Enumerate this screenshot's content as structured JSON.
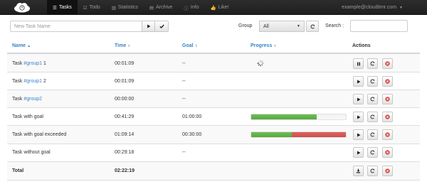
{
  "nav": {
    "logo_icon": "cloud-clock-icon",
    "items": [
      {
        "label": "Tasks",
        "icon": "list-icon",
        "glyph": "☰",
        "active": true
      },
      {
        "label": "Todo",
        "icon": "checkbox-icon",
        "glyph": "☑",
        "active": false
      },
      {
        "label": "Statistics",
        "icon": "bar-chart-icon",
        "glyph": "▥",
        "active": false
      },
      {
        "label": "Archive",
        "icon": "archive-icon",
        "glyph": "▤",
        "active": false
      },
      {
        "label": "Info",
        "icon": "info-icon",
        "glyph": "ⓘ",
        "active": false
      },
      {
        "label": "Like!",
        "icon": "thumbs-up-icon",
        "glyph": "👍",
        "active": false
      }
    ],
    "user_email": "example@cloudtimr.com"
  },
  "toolbar": {
    "task_placeholder": "New Task Name",
    "start_icon": "play-icon",
    "confirm_icon": "check-icon",
    "group_label": "Group",
    "group_value": "All",
    "refresh_icon": "refresh-icon",
    "search_label": "Search :",
    "search_value": ""
  },
  "table": {
    "headers": {
      "name": "Name",
      "time": "Time",
      "goal": "Goal",
      "progress": "Progress",
      "actions": "Actions"
    },
    "rows": [
      {
        "name": "Task ",
        "tag": "#group1",
        "suffix": " 1",
        "time": "00:01:09",
        "goal": "--",
        "progress": null,
        "running": true
      },
      {
        "name": "Task ",
        "tag": "#group1",
        "suffix": " 2",
        "time": "00:01:09",
        "goal": "--",
        "progress": null,
        "running": false
      },
      {
        "name": "Task ",
        "tag": "#group2",
        "suffix": "",
        "time": "00:00:00",
        "goal": "--",
        "progress": null,
        "running": false
      },
      {
        "name": "Task with goal",
        "tag": "",
        "suffix": "",
        "time": "00:41:29",
        "goal": "01:00:00",
        "progress": 0.69,
        "running": false
      },
      {
        "name": "Task with goal exceeded",
        "tag": "",
        "suffix": "",
        "time": "01:09:14",
        "goal": "00:30:00",
        "progress": 1.0,
        "over": 0.57,
        "running": false
      },
      {
        "name": "Task without goal",
        "tag": "",
        "suffix": "",
        "time": "00:29:18",
        "goal": "--",
        "progress": null,
        "running": false
      }
    ],
    "total": {
      "label": "Total",
      "time": "02:22:19"
    }
  },
  "colors": {
    "accent": "#3a83c8",
    "progress_ok": "#5cb247",
    "progress_over": "#cc5452",
    "delete": "#d9423e"
  }
}
